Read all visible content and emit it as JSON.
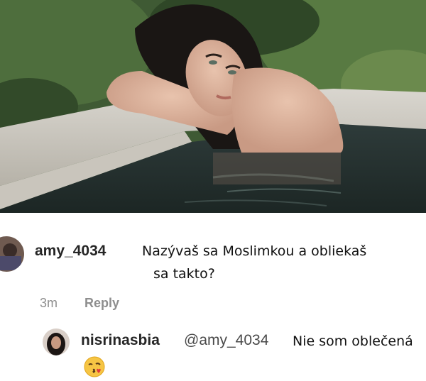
{
  "comments": [
    {
      "username": "amy_4034",
      "text_line1": "Nazývaš sa Moslimkou a obliekaš",
      "text_line2": "sa takto?",
      "time": "3m",
      "reply_label": "Reply",
      "avatar_icon": "user-avatar-icon"
    },
    {
      "username": "nisrinasbia",
      "mention": "@amy_4034",
      "text": "Nie som oblečená",
      "emoji_icon": "kissing-face-emoji-icon",
      "avatar_icon": "user-avatar-icon"
    }
  ],
  "colors": {
    "username": "#262626",
    "meta": "#8e8e8e",
    "text": "#111111"
  }
}
